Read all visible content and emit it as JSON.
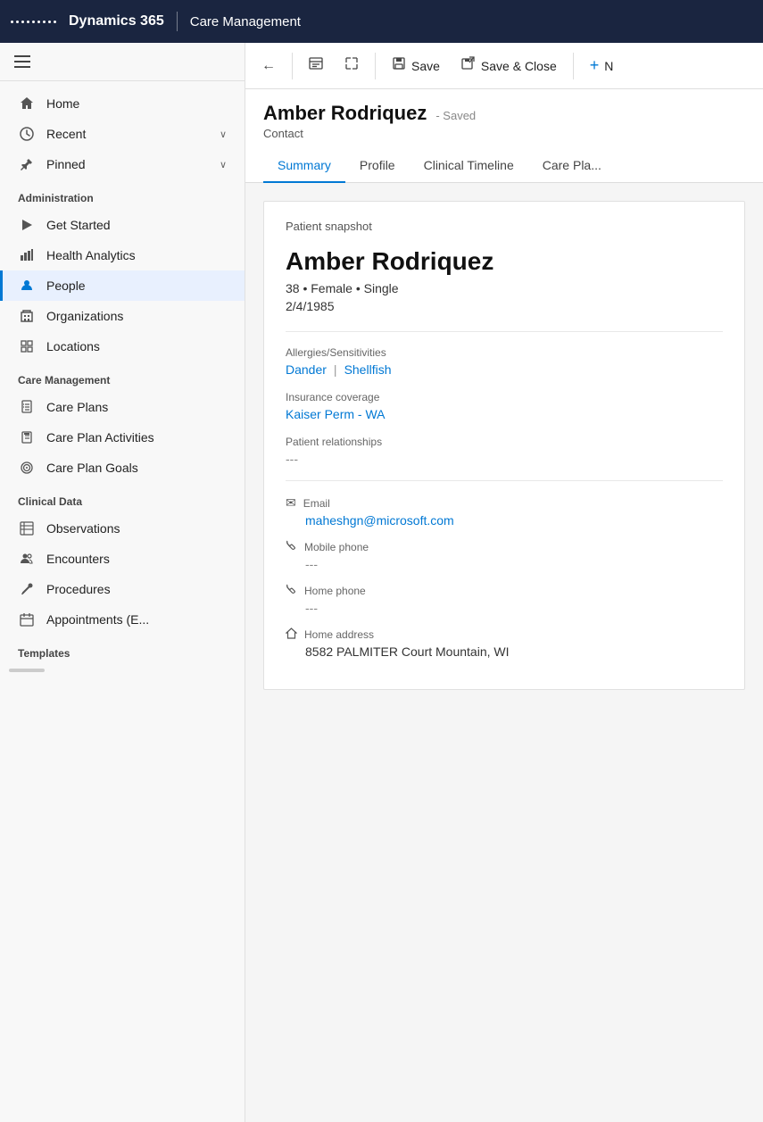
{
  "topbar": {
    "app_name": "Dynamics 365",
    "module_name": "Care Management"
  },
  "toolbar": {
    "back_label": "",
    "form_icon": "",
    "expand_label": "",
    "save_label": "Save",
    "save_close_label": "Save & Close",
    "new_label": "N"
  },
  "page": {
    "title": "Amber Rodriquez",
    "saved_status": "- Saved",
    "subtitle": "Contact"
  },
  "tabs": [
    {
      "id": "summary",
      "label": "Summary",
      "active": true
    },
    {
      "id": "profile",
      "label": "Profile",
      "active": false
    },
    {
      "id": "clinical-timeline",
      "label": "Clinical Timeline",
      "active": false
    },
    {
      "id": "care-plan",
      "label": "Care Pla...",
      "active": false
    }
  ],
  "sidebar": {
    "sections": [
      {
        "type": "nav",
        "items": [
          {
            "id": "home",
            "label": "Home",
            "icon": "home",
            "active": false
          },
          {
            "id": "recent",
            "label": "Recent",
            "icon": "clock",
            "chevron": true,
            "active": false
          },
          {
            "id": "pinned",
            "label": "Pinned",
            "icon": "pin",
            "chevron": true,
            "active": false
          }
        ]
      },
      {
        "type": "section",
        "title": "Administration",
        "items": [
          {
            "id": "get-started",
            "label": "Get Started",
            "icon": "play",
            "active": false
          },
          {
            "id": "health-analytics",
            "label": "Health Analytics",
            "icon": "analytics",
            "active": false
          },
          {
            "id": "people",
            "label": "People",
            "icon": "person",
            "active": true
          },
          {
            "id": "organizations",
            "label": "Organizations",
            "icon": "building",
            "active": false
          },
          {
            "id": "locations",
            "label": "Locations",
            "icon": "grid",
            "active": false
          }
        ]
      },
      {
        "type": "section",
        "title": "Care Management",
        "items": [
          {
            "id": "care-plans",
            "label": "Care Plans",
            "icon": "document",
            "active": false
          },
          {
            "id": "care-plan-activities",
            "label": "Care Plan Activities",
            "icon": "clipboard",
            "active": false
          },
          {
            "id": "care-plan-goals",
            "label": "Care Plan Goals",
            "icon": "target",
            "active": false
          }
        ]
      },
      {
        "type": "section",
        "title": "Clinical Data",
        "items": [
          {
            "id": "observations",
            "label": "Observations",
            "icon": "table",
            "active": false
          },
          {
            "id": "encounters",
            "label": "Encounters",
            "icon": "people",
            "active": false
          },
          {
            "id": "procedures",
            "label": "Procedures",
            "icon": "syringe",
            "active": false
          },
          {
            "id": "appointments",
            "label": "Appointments (E...",
            "icon": "calendar",
            "active": false
          }
        ]
      },
      {
        "type": "section",
        "title": "Templates",
        "items": []
      }
    ]
  },
  "patient_snapshot": {
    "section_title": "Patient snapshot",
    "name": "Amber Rodriquez",
    "age": "38",
    "gender": "Female",
    "status": "Single",
    "demographics_line": "38 • Female • Single",
    "dob": "2/4/1985",
    "allergies_label": "Allergies/Sensitivities",
    "allergies": [
      {
        "label": "Dander"
      },
      {
        "label": "Shellfish"
      }
    ],
    "insurance_label": "Insurance coverage",
    "insurance_value": "Kaiser Perm - WA",
    "relationships_label": "Patient relationships",
    "relationships_value": "---",
    "email_label": "Email",
    "email_value": "maheshgn@microsoft.com",
    "mobile_phone_label": "Mobile phone",
    "mobile_phone_value": "---",
    "home_phone_label": "Home phone",
    "home_phone_value": "---",
    "home_address_label": "Home address",
    "home_address_value": "8582 PALMITER Court Mountain, WI"
  }
}
